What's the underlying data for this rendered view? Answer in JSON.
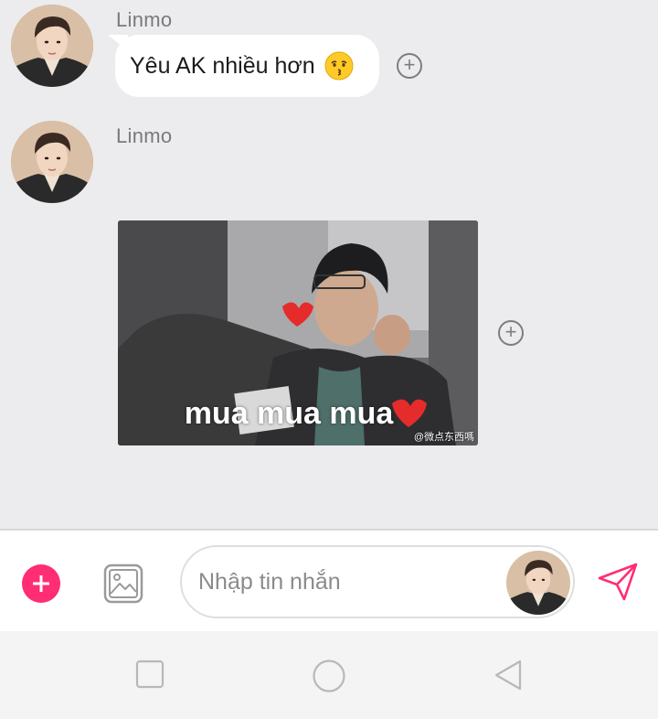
{
  "messages": [
    {
      "sender": "Linmo",
      "text": "Yêu AK nhiều hơn",
      "emoji": "kissing-face-emoji",
      "type": "text"
    },
    {
      "sender": "Linmo",
      "type": "gif",
      "gif_caption": "mua mua mua",
      "gif_watermark": "@微点东西嗎"
    }
  ],
  "composer": {
    "placeholder": "Nhập tin nhắn",
    "value": ""
  },
  "icons": {
    "add": "plus-circle-icon",
    "image": "image-picker-icon",
    "send": "paper-plane-icon",
    "react": "add-reaction-icon",
    "nav_recent": "square-icon",
    "nav_home": "circle-icon",
    "nav_back": "triangle-back-icon"
  },
  "colors": {
    "accent": "#ff2d73",
    "chat_bg": "#ececee",
    "bubble_bg": "#ffffff",
    "sender_text": "#7a7a7a"
  }
}
